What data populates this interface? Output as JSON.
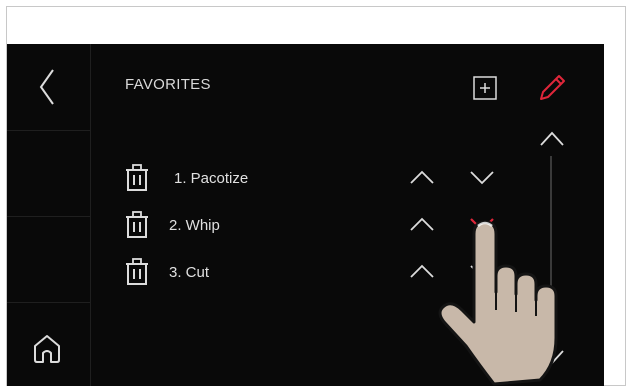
{
  "header": {
    "title": "FAVORITES"
  },
  "sidebar": {
    "back_icon": "chevron-left-icon",
    "home_icon": "home-icon"
  },
  "toolbar": {
    "add_icon": "plus-square-icon",
    "edit_icon": "pencil-icon",
    "edit_color": "#e0263a"
  },
  "favorites": [
    {
      "label": "1. Pacotize"
    },
    {
      "label": "2. Whip"
    },
    {
      "label": "3. Cut"
    }
  ],
  "colors": {
    "background": "#090909",
    "text": "#e0e0e0",
    "accent": "#e0263a",
    "hand": "#c8b8a9"
  }
}
